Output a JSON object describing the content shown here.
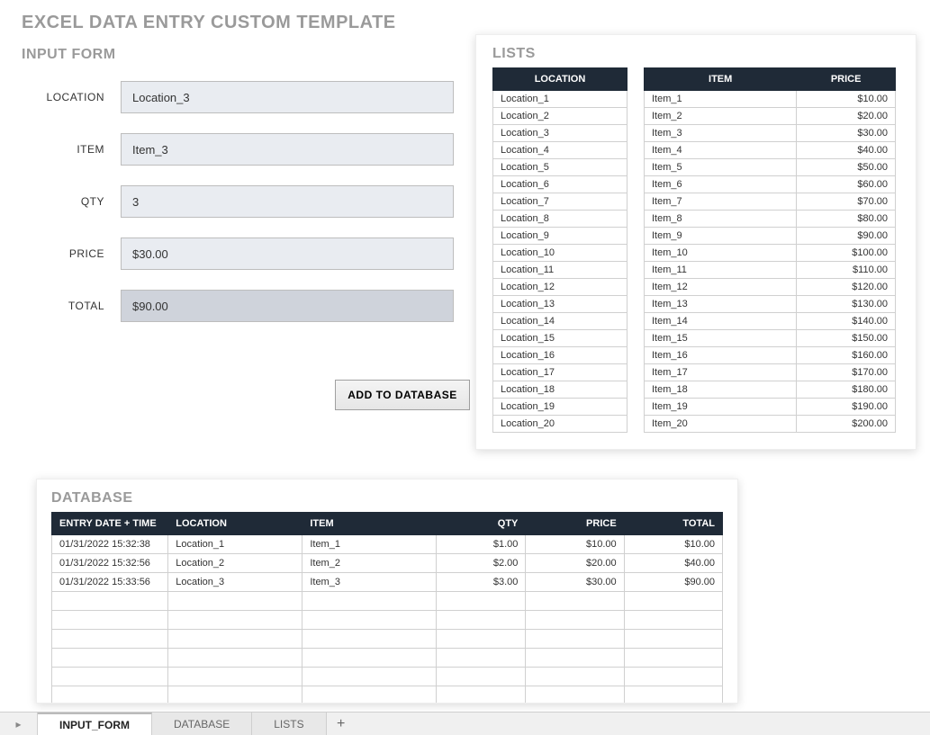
{
  "title": "EXCEL DATA ENTRY CUSTOM TEMPLATE",
  "input_form": {
    "heading": "INPUT FORM",
    "labels": {
      "location": "LOCATION",
      "item": "ITEM",
      "qty": "QTY",
      "price": "PRICE",
      "total": "TOTAL"
    },
    "values": {
      "location": "Location_3",
      "item": "Item_3",
      "qty": "3",
      "price": "$30.00",
      "total": "$90.00"
    },
    "button": "ADD TO DATABASE"
  },
  "lists": {
    "heading": "LISTS",
    "location_header": "LOCATION",
    "item_header": "ITEM",
    "price_header": "PRICE",
    "locations": [
      "Location_1",
      "Location_2",
      "Location_3",
      "Location_4",
      "Location_5",
      "Location_6",
      "Location_7",
      "Location_8",
      "Location_9",
      "Location_10",
      "Location_11",
      "Location_12",
      "Location_13",
      "Location_14",
      "Location_15",
      "Location_16",
      "Location_17",
      "Location_18",
      "Location_19",
      "Location_20"
    ],
    "items": [
      {
        "name": "Item_1",
        "price": "$10.00"
      },
      {
        "name": "Item_2",
        "price": "$20.00"
      },
      {
        "name": "Item_3",
        "price": "$30.00"
      },
      {
        "name": "Item_4",
        "price": "$40.00"
      },
      {
        "name": "Item_5",
        "price": "$50.00"
      },
      {
        "name": "Item_6",
        "price": "$60.00"
      },
      {
        "name": "Item_7",
        "price": "$70.00"
      },
      {
        "name": "Item_8",
        "price": "$80.00"
      },
      {
        "name": "Item_9",
        "price": "$90.00"
      },
      {
        "name": "Item_10",
        "price": "$100.00"
      },
      {
        "name": "Item_11",
        "price": "$110.00"
      },
      {
        "name": "Item_12",
        "price": "$120.00"
      },
      {
        "name": "Item_13",
        "price": "$130.00"
      },
      {
        "name": "Item_14",
        "price": "$140.00"
      },
      {
        "name": "Item_15",
        "price": "$150.00"
      },
      {
        "name": "Item_16",
        "price": "$160.00"
      },
      {
        "name": "Item_17",
        "price": "$170.00"
      },
      {
        "name": "Item_18",
        "price": "$180.00"
      },
      {
        "name": "Item_19",
        "price": "$190.00"
      },
      {
        "name": "Item_20",
        "price": "$200.00"
      }
    ]
  },
  "database": {
    "heading": "DATABASE",
    "headers": {
      "entry": "ENTRY DATE + TIME",
      "location": "LOCATION",
      "item": "ITEM",
      "qty": "QTY",
      "price": "PRICE",
      "total": "TOTAL"
    },
    "rows": [
      {
        "entry": "01/31/2022 15:32:38",
        "location": "Location_1",
        "item": "Item_1",
        "qty": "$1.00",
        "price": "$10.00",
        "total": "$10.00"
      },
      {
        "entry": "01/31/2022 15:32:56",
        "location": "Location_2",
        "item": "Item_2",
        "qty": "$2.00",
        "price": "$20.00",
        "total": "$40.00"
      },
      {
        "entry": "01/31/2022 15:33:56",
        "location": "Location_3",
        "item": "Item_3",
        "qty": "$3.00",
        "price": "$30.00",
        "total": "$90.00"
      }
    ],
    "blank_rows": 6
  },
  "tabs": {
    "items": [
      "INPUT_FORM",
      "DATABASE",
      "LISTS"
    ],
    "active": 0
  }
}
